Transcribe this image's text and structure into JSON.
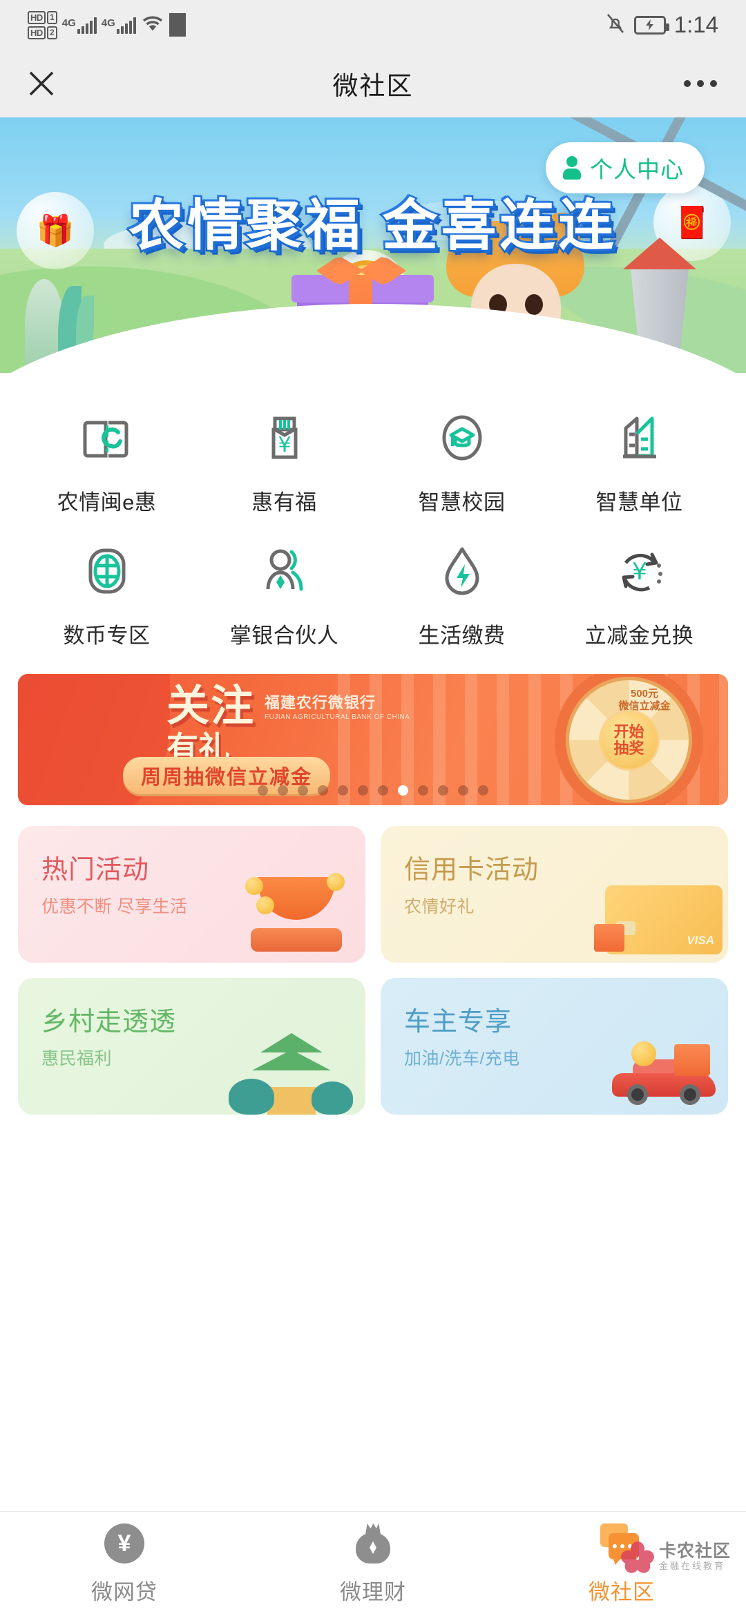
{
  "status_bar": {
    "hd1_label": "HD",
    "hd1_num": "1",
    "hd2_label": "HD",
    "hd2_num": "2",
    "network1": "4G",
    "network2": "4G",
    "wifi_icon": "wifi-icon",
    "mute_icon": "mute-bell-icon",
    "battery_icon": "charging-battery-icon",
    "time": "1:14"
  },
  "header": {
    "title": "微社区",
    "close_icon": "close-icon",
    "more_icon": "more-options-icon"
  },
  "hero": {
    "title": "农情聚福 金喜连连",
    "profile_button": "个人中心",
    "profile_icon": "person-icon",
    "coin_symbol": "¥"
  },
  "grid": {
    "items": [
      {
        "label": "农情闽e惠",
        "icon": "book-e-icon"
      },
      {
        "label": "惠有福",
        "icon": "voucher-yen-icon"
      },
      {
        "label": "智慧校园",
        "icon": "graduation-cap-icon"
      },
      {
        "label": "智慧单位",
        "icon": "building-icon"
      },
      {
        "label": "数币专区",
        "icon": "digital-currency-icon"
      },
      {
        "label": "掌银合伙人",
        "icon": "partner-people-icon"
      },
      {
        "label": "生活缴费",
        "icon": "water-drop-bolt-icon"
      },
      {
        "label": "立减金兑换",
        "icon": "exchange-yen-icon"
      }
    ]
  },
  "banner": {
    "brand_cn": "福建农行微银行",
    "brand_en": "FUJIAN AGRICULTURAL BANK OF CHINA",
    "headline": "关注",
    "headline2": "有礼",
    "subtitle": "周周抽微信立减金",
    "wheel_prize": "500元",
    "wheel_prize_sub": "微信立减金",
    "wheel_button_line1": "开始",
    "wheel_button_line2": "抽奖",
    "dots_total": 12,
    "dots_active_index": 7
  },
  "cards": [
    {
      "title": "热门活动",
      "subtitle": "优惠不断 尽享生活",
      "art": "lucky-pot-icon"
    },
    {
      "title": "信用卡活动",
      "subtitle": "农情好礼",
      "art": "credit-card-icon",
      "card_brand": "VISA"
    },
    {
      "title": "乡村走透透",
      "subtitle": "惠民福利",
      "art": "pagoda-icon"
    },
    {
      "title": "车主专享",
      "subtitle": "加油/洗车/充电",
      "art": "car-icon"
    }
  ],
  "tabbar": {
    "items": [
      {
        "label": "微网贷",
        "icon": "yen-circle-icon",
        "active": false
      },
      {
        "label": "微理财",
        "icon": "money-bag-icon",
        "active": false
      },
      {
        "label": "微社区",
        "icon": "community-chat-icon",
        "active": true
      }
    ],
    "active_color": "#f5922f"
  },
  "watermark": {
    "main": "卡农社区",
    "sub": "金融在线教育",
    "logo_icon": "flower-logo-icon"
  }
}
